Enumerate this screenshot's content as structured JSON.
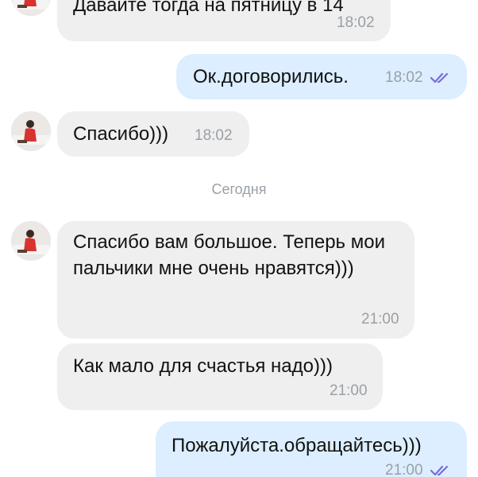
{
  "messages": [
    {
      "text": "Давайте тогда на пятницу в 14",
      "time": "18:02",
      "direction": "incoming"
    },
    {
      "text": "Ок.договорились.",
      "time": "18:02",
      "direction": "outgoing",
      "read_icon": "double-check-icon"
    },
    {
      "text": "Спасибо)))",
      "time": "18:02",
      "direction": "incoming"
    },
    {
      "text": "Спасибо вам большое. Теперь мои пальчики мне очень нравятся)))",
      "time": "21:00",
      "direction": "incoming"
    },
    {
      "text": "Как мало для счастья надо)))",
      "time": "21:00",
      "direction": "incoming"
    },
    {
      "text": "Пожалуйста.обращайтесь)))",
      "time": "21:00",
      "direction": "outgoing",
      "read_icon": "double-check-icon"
    }
  ],
  "date_separator": "Сегодня",
  "colors": {
    "incoming_bubble": "#efefef",
    "outgoing_bubble": "#dceeff",
    "timestamp": "#9aa0a6",
    "read_check": "#7b6cd8"
  }
}
